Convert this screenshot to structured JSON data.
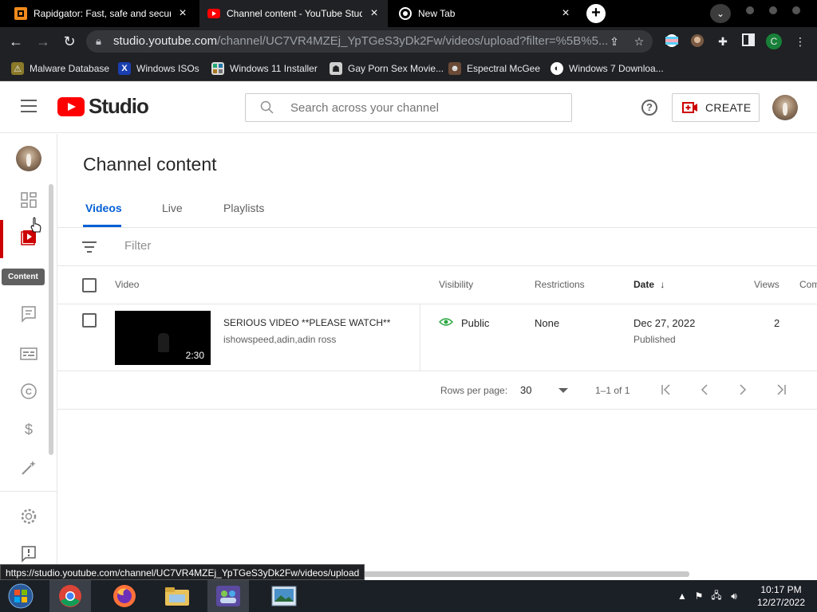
{
  "browser": {
    "tabs": [
      {
        "title": "Rapidgator: Fast, safe and secure",
        "active": false
      },
      {
        "title": "Channel content - YouTube Studio",
        "active": true
      },
      {
        "title": "New Tab",
        "active": false
      }
    ],
    "url_host": "studio.youtube.com",
    "url_path": "/channel/UC7VR4MZEj_YpTGeS3yDk2Fw/videos/upload?filter=%5B%5...",
    "profile_letter": "C",
    "bookmarks": [
      {
        "label": "Malware Database",
        "icon": "malware-icon"
      },
      {
        "label": "Windows ISOs",
        "icon": "x-icon"
      },
      {
        "label": "Windows 11 Installer",
        "icon": "installer-icon"
      },
      {
        "label": "Gay Porn Sex Movie...",
        "icon": "site-icon"
      },
      {
        "label": "Espectral McGee",
        "icon": "espectral-icon"
      },
      {
        "label": "Windows 7 Downloa...",
        "icon": "globe-icon"
      }
    ],
    "status_url": "https://studio.youtube.com/channel/UC7VR4MZEj_YpTGeS3yDk2Fw/videos/upload"
  },
  "studio": {
    "logo_text": "Studio",
    "search_placeholder": "Search across your channel",
    "create_label": "CREATE",
    "rail_tooltip": "Content",
    "page_title": "Channel content",
    "tabs": [
      "Videos",
      "Live",
      "Playlists"
    ],
    "filter_label": "Filter",
    "columns": {
      "video": "Video",
      "visibility": "Visibility",
      "restrictions": "Restrictions",
      "date": "Date",
      "views": "Views",
      "comments": "Com"
    },
    "rows": [
      {
        "title": "SERIOUS VIDEO **PLEASE WATCH**",
        "description": "ishowspeed,adin,adin ross",
        "duration": "2:30",
        "visibility": "Public",
        "restrictions": "None",
        "date": "Dec 27, 2022",
        "status": "Published",
        "views": "2"
      }
    ],
    "pager": {
      "rows_per_page_label": "Rows per page:",
      "rows_per_page": "30",
      "range": "1–1 of 1"
    }
  },
  "taskbar": {
    "time": "10:17 PM",
    "date": "12/27/2022"
  },
  "colors": {
    "accent": "#065fd4",
    "youtube_red": "#ff0000",
    "rail_active": "#cc0000",
    "public_green": "#2ba640"
  }
}
